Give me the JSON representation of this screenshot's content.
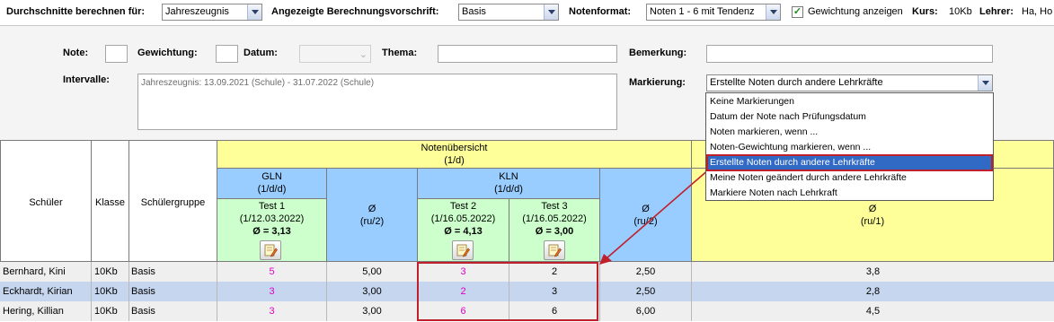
{
  "toolbar": {
    "durchschnitte_label": "Durchschnitte berechnen für:",
    "durchschnitte_value": "Jahreszeugnis",
    "vorschrift_label": "Angezeigte Berechnungsvorschrift:",
    "vorschrift_value": "Basis",
    "notenformat_label": "Notenformat:",
    "notenformat_value": "Noten 1 - 6 mit Tendenz",
    "gewichtung_label": "Gewichtung anzeigen",
    "gewichtung_checked": true,
    "kurs_label": "Kurs:",
    "kurs_value": "10Kb",
    "lehrer_label": "Lehrer:",
    "lehrer_value": "Ha, Ho"
  },
  "form": {
    "note_label": "Note:",
    "note_value": "",
    "gewichtung_label": "Gewichtung:",
    "gewichtung_value": "",
    "datum_label": "Datum:",
    "datum_value": "",
    "thema_label": "Thema:",
    "thema_value": "",
    "bemerkung_label": "Bemerkung:",
    "bemerkung_value": "",
    "intervalle_label": "Intervalle:",
    "intervalle_text": "Jahreszeugnis: 13.09.2021 (Schule) - 31.07.2022 (Schule)",
    "markierung_label": "Markierung:",
    "markierung_value": "Erstellte Noten durch andere Lehrkräfte"
  },
  "markierung_options": [
    "Keine Markierungen",
    "Datum der Note nach Prüfungsdatum",
    "Noten markieren, wenn ...",
    "Noten-Gewichtung markieren, wenn ...",
    "Erstellte Noten durch andere Lehrkräfte",
    "Meine Noten geändert durch andere Lehrkräfte",
    "Markiere Noten nach Lehrkraft"
  ],
  "markierung_selected_index": 4,
  "grid": {
    "col_schueler": "Schüler",
    "col_klasse": "Klasse",
    "col_gruppe": "Schülergruppe",
    "notenuebersicht": "Notenübersicht",
    "notenuebersicht_sub": "(1/d)",
    "gln": "GLN",
    "gln_sub": "(1/d/d)",
    "kln": "KLN",
    "kln_sub": "(1/d/d)",
    "avg_symbol": "Ø",
    "avg_ru2": "(ru/2)",
    "avg_ru1": "(ru/1)",
    "test1": {
      "name": "Test 1",
      "date": "(1/12.03.2022)",
      "avg": "Ø = 3,13"
    },
    "test2": {
      "name": "Test 2",
      "date": "(1/16.05.2022)",
      "avg": "Ø = 4,13"
    },
    "test3": {
      "name": "Test 3",
      "date": "(1/16.05.2022)",
      "avg": "Ø = 3,00"
    }
  },
  "rows": [
    {
      "name": "Bernhard, Kini",
      "klasse": "10Kb",
      "gruppe": "Basis",
      "t1": "5",
      "gln_avg": "5,00",
      "t2": "3",
      "t3": "2",
      "kln_avg": "2,50",
      "total": "3,8"
    },
    {
      "name": "Eckhardt, Kirian",
      "klasse": "10Kb",
      "gruppe": "Basis",
      "t1": "3",
      "gln_avg": "3,00",
      "t2": "2",
      "t3": "3",
      "kln_avg": "2,50",
      "total": "2,8"
    },
    {
      "name": "Hering, Killian",
      "klasse": "10Kb",
      "gruppe": "Basis",
      "t1": "3",
      "gln_avg": "3,00",
      "t2": "6",
      "t3": "6",
      "kln_avg": "6,00",
      "total": "4,5"
    }
  ],
  "colors": {
    "header_yellow": "#ffff99",
    "header_blue": "#99ccff",
    "header_green": "#ccffcc",
    "other_teacher_grade": "#e000c8",
    "highlight_red": "#c0202b",
    "selection_blue": "#316ac5"
  }
}
